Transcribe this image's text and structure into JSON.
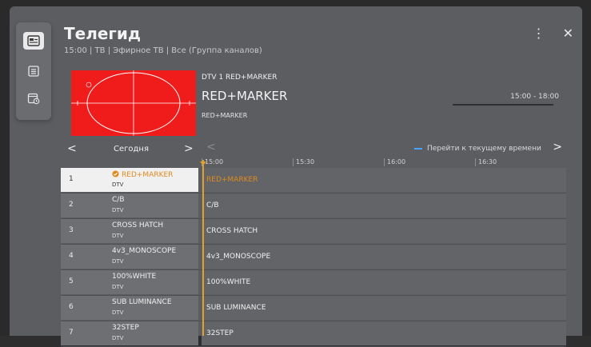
{
  "header": {
    "title": "Телегид",
    "subtitle": "15:00 | ТВ | Эфирное ТВ | Все (Группа каналов)"
  },
  "icons": {
    "more": "more-vertical-icon",
    "close": "close-icon"
  },
  "current_program": {
    "channel_line": "DTV 1 RED+MARKER",
    "title": "RED+MARKER",
    "description": "RED+MARKER",
    "time_range": "15:00 - 18:00",
    "progress": 0.0
  },
  "date_nav": {
    "label": "Сегодня"
  },
  "timeline": {
    "goto_now_label": "Перейти к текущему времени",
    "ticks": [
      "15:00",
      "15:30",
      "16:00",
      "16:30"
    ]
  },
  "channels": [
    {
      "num": "1",
      "name": "RED+MARKER",
      "type": "DTV",
      "program": "RED+MARKER",
      "selected": true
    },
    {
      "num": "2",
      "name": "C/B",
      "type": "DTV",
      "program": "C/B"
    },
    {
      "num": "3",
      "name": "CROSS HATCH",
      "type": "DTV",
      "program": "CROSS HATCH"
    },
    {
      "num": "4",
      "name": "4v3_MONOSCOPE",
      "type": "DTV",
      "program": "4v3_MONOSCOPE"
    },
    {
      "num": "5",
      "name": "100%WHITE",
      "type": "DTV",
      "program": "100%WHITE"
    },
    {
      "num": "6",
      "name": "SUB LUMINANCE",
      "type": "DTV",
      "program": "SUB LUMINANCE"
    },
    {
      "num": "7",
      "name": "32STEP",
      "type": "DTV",
      "program": "32STEP"
    }
  ],
  "colors": {
    "accent": "#e08a1e",
    "now_line": "#e0a030",
    "goto_now": "#4aa3ff",
    "preview_bg": "#f01c1c"
  }
}
